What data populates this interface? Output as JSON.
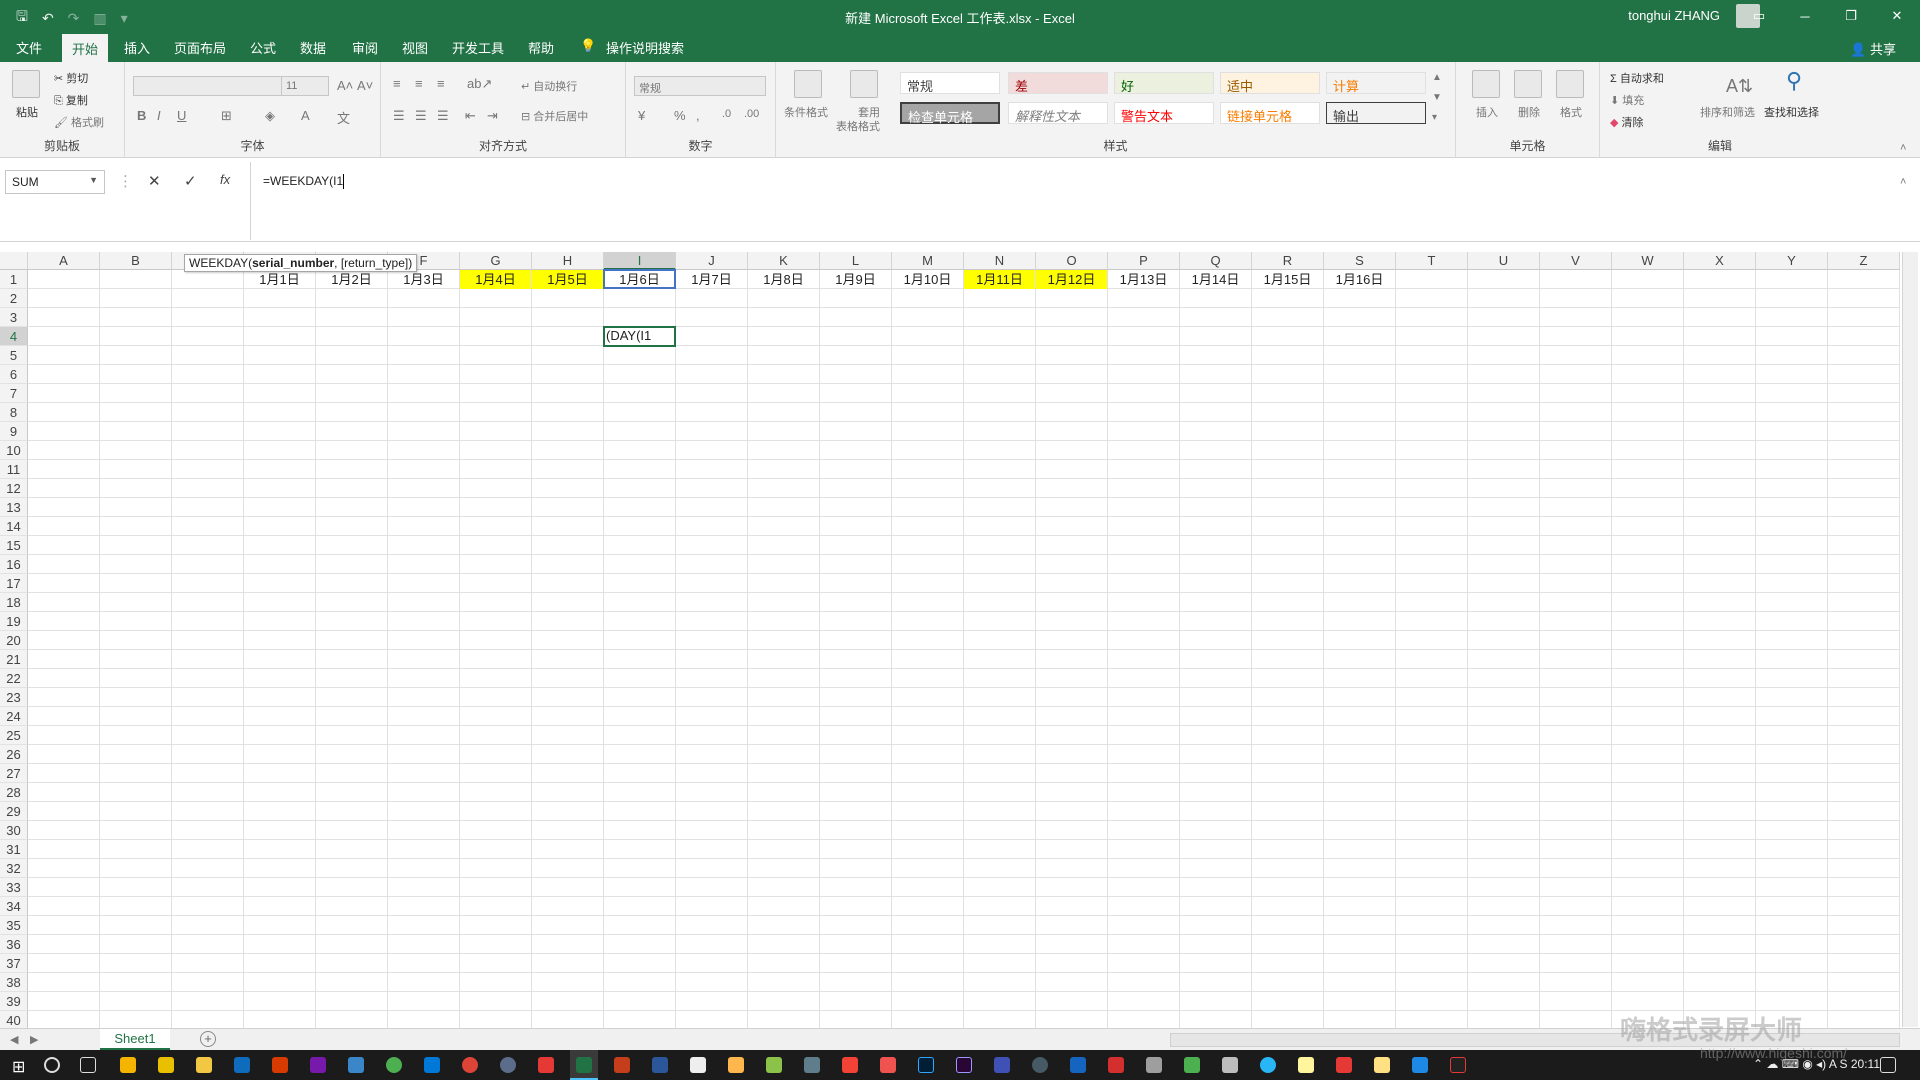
{
  "titlebar": {
    "title": "新建 Microsoft Excel 工作表.xlsx  -  Excel",
    "user": "tonghui ZHANG",
    "minimize": "─",
    "restore": "❐",
    "close": "✕"
  },
  "tabs": {
    "file": "文件",
    "home": "开始",
    "insert": "插入",
    "page_layout": "页面布局",
    "formulas": "公式",
    "data": "数据",
    "review": "审阅",
    "view": "视图",
    "developer": "开发工具",
    "help": "帮助",
    "tell_me": "操作说明搜索",
    "share": "共享"
  },
  "ribbon": {
    "clipboard": {
      "label": "剪贴板",
      "paste": "粘贴",
      "cut": "剪切",
      "copy": "复制",
      "format_painter": "格式刷"
    },
    "font": {
      "label": "字体",
      "size": "11",
      "bold": "B",
      "italic": "I",
      "underline": "U"
    },
    "alignment": {
      "label": "对齐方式",
      "wrap": "自动换行",
      "merge": "合并后居中"
    },
    "number": {
      "label": "数字",
      "format": "常规",
      "percent": "%"
    },
    "styles": {
      "label": "样式",
      "conditional": "条件格式",
      "table_format_1": "套用",
      "table_format_2": "表格格式",
      "normal": "常规",
      "bad": "差",
      "good": "好",
      "neutral": "适中",
      "calculation": "计算",
      "check_cell": "检查单元格",
      "explanatory": "解释性文本",
      "warning": "警告文本",
      "linked": "链接单元格",
      "output": "输出"
    },
    "cells": {
      "label": "单元格",
      "insert": "插入",
      "delete": "删除",
      "format": "格式"
    },
    "editing": {
      "label": "编辑",
      "autosum": "自动求和",
      "fill": "填充",
      "clear": "清除",
      "sort": "排序和筛选",
      "find": "查找和选择"
    }
  },
  "formula_bar": {
    "name_box": "SUM",
    "cancel": "✕",
    "enter": "✓",
    "fx": "fx",
    "formula": "=WEEKDAY(I1"
  },
  "tooltip": {
    "fn": "WEEKDAY(",
    "arg1": "serial_number",
    "rest": ", [return_type])"
  },
  "columns": [
    "A",
    "B",
    "C",
    "D",
    "E",
    "F",
    "G",
    "H",
    "I",
    "J",
    "K",
    "L",
    "M",
    "N",
    "O",
    "P",
    "Q",
    "R",
    "S",
    "T",
    "U",
    "V",
    "W",
    "X",
    "Y",
    "Z"
  ],
  "rows": [
    "1",
    "2",
    "3",
    "4",
    "5",
    "6",
    "7",
    "8",
    "9",
    "10",
    "11",
    "12",
    "13",
    "14",
    "15",
    "16",
    "17",
    "18",
    "19",
    "20",
    "21",
    "22",
    "23",
    "24",
    "25",
    "26",
    "27",
    "28",
    "29",
    "30",
    "31",
    "32",
    "33",
    "34",
    "35",
    "36",
    "37",
    "38",
    "39",
    "40"
  ],
  "row1_cells": [
    {
      "col": "D",
      "text": "1月1日",
      "highlight": false
    },
    {
      "col": "E",
      "text": "1月2日",
      "highlight": false
    },
    {
      "col": "F",
      "text": "1月3日",
      "highlight": false
    },
    {
      "col": "G",
      "text": "1月4日",
      "highlight": true
    },
    {
      "col": "H",
      "text": "1月5日",
      "highlight": true
    },
    {
      "col": "I",
      "text": "1月6日",
      "highlight": false
    },
    {
      "col": "J",
      "text": "1月7日",
      "highlight": false
    },
    {
      "col": "K",
      "text": "1月8日",
      "highlight": false
    },
    {
      "col": "L",
      "text": "1月9日",
      "highlight": false
    },
    {
      "col": "M",
      "text": "1月10日",
      "highlight": false
    },
    {
      "col": "N",
      "text": "1月11日",
      "highlight": true
    },
    {
      "col": "O",
      "text": "1月12日",
      "highlight": true
    },
    {
      "col": "P",
      "text": "1月13日",
      "highlight": false
    },
    {
      "col": "Q",
      "text": "1月14日",
      "highlight": false
    },
    {
      "col": "R",
      "text": "1月15日",
      "highlight": false
    },
    {
      "col": "S",
      "text": "1月16日",
      "highlight": false
    }
  ],
  "active_cell": {
    "col": "I",
    "row": "4",
    "text": "(DAY(I1"
  },
  "highlight_color": "#ffff00",
  "accent_color": "#217346",
  "sheet": {
    "name": "Sheet1",
    "add": "+"
  },
  "taskbar": {
    "clock": "20:11"
  },
  "watermark": {
    "line1": "嗨格式录屏大师",
    "line2": "http://www.higeshi.com/"
  }
}
